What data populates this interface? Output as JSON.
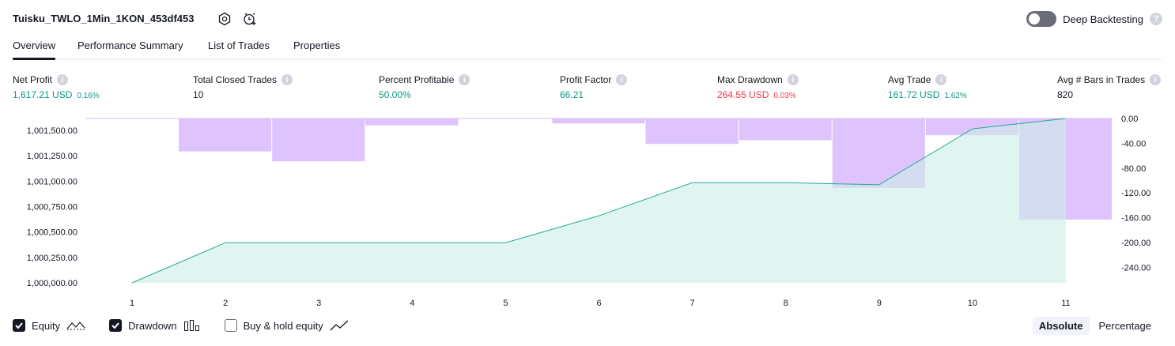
{
  "header": {
    "strategy_name": "Tuisku_TWLO_1Min_1KON_453df453",
    "deep_backtesting_label": "Deep Backtesting",
    "deep_backtesting_enabled": false
  },
  "tabs": [
    {
      "label": "Overview",
      "active": true
    },
    {
      "label": "Performance Summary",
      "active": false
    },
    {
      "label": "List of Trades",
      "active": false
    },
    {
      "label": "Properties",
      "active": false
    }
  ],
  "metrics": [
    {
      "label": "Net Profit",
      "value": "1,617.21 USD",
      "sub": "0.16%",
      "color": "green"
    },
    {
      "label": "Total Closed Trades",
      "value": "10",
      "sub": "",
      "color": "dark"
    },
    {
      "label": "Percent Profitable",
      "value": "50.00%",
      "sub": "",
      "color": "green"
    },
    {
      "label": "Profit Factor",
      "value": "66.21",
      "sub": "",
      "color": "green"
    },
    {
      "label": "Max Drawdown",
      "value": "264.55 USD",
      "sub": "0.03%",
      "color": "red"
    },
    {
      "label": "Avg Trade",
      "value": "161.72 USD",
      "sub": "1.62%",
      "color": "green"
    },
    {
      "label": "Avg # Bars in Trades",
      "value": "820",
      "sub": "",
      "color": "dark"
    }
  ],
  "chart_data": {
    "type": "line",
    "x": [
      1,
      2,
      3,
      4,
      5,
      6,
      7,
      8,
      9,
      10,
      11
    ],
    "series": [
      {
        "name": "Equity",
        "axis": "left",
        "values": [
          1000000,
          1000395,
          1000395,
          1000395,
          1000395,
          1000660,
          1000985,
          1000985,
          1000965,
          1001515,
          1001617
        ]
      },
      {
        "name": "Drawdown",
        "axis": "right",
        "values": [
          0,
          -53,
          -69,
          -11,
          0,
          -8,
          -41,
          -35,
          -112,
          -27,
          -163
        ]
      }
    ],
    "left_axis_ticks": [
      "1,001,500.00",
      "1,001,250.00",
      "1,001,000.00",
      "1,000,750.00",
      "1,000,500.00",
      "1,000,250.00",
      "1,000,000.00"
    ],
    "right_axis_ticks": [
      "0.00",
      "-40.00",
      "-80.00",
      "-120.00",
      "-160.00",
      "-200.00",
      "-240.00"
    ],
    "x_ticks": [
      "1",
      "2",
      "3",
      "4",
      "5",
      "6",
      "7",
      "8",
      "9",
      "10",
      "11"
    ],
    "ylim_left": [
      1000000,
      1001617
    ],
    "ylim_right": [
      -265,
      0
    ],
    "colors": {
      "equity_line": "#22ab94",
      "equity_fill": "#cdeee6",
      "drawdown_fill": "#d9b8fb"
    }
  },
  "legend": {
    "items": [
      {
        "label": "Equity",
        "checked": true,
        "icon": "equity-line-icon"
      },
      {
        "label": "Drawdown",
        "checked": true,
        "icon": "drawdown-bars-icon"
      },
      {
        "label": "Buy & hold equity",
        "checked": false,
        "icon": "buy-hold-line-icon"
      }
    ],
    "modes": [
      {
        "label": "Absolute",
        "active": true
      },
      {
        "label": "Percentage",
        "active": false
      }
    ]
  }
}
